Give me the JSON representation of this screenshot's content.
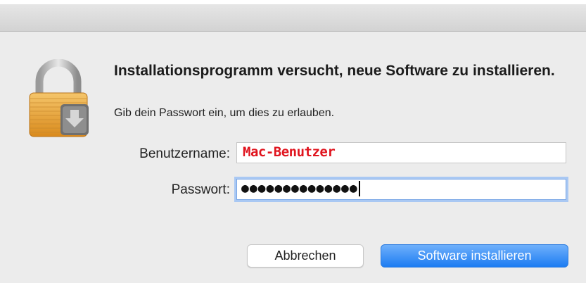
{
  "dialog": {
    "title": "Installationsprogramm versucht, neue Software zu installieren.",
    "subtitle": "Gib dein Passwort ein, um dies zu erlauben.",
    "icon": "lock-icon",
    "username_label": "Benutzername:",
    "username_value": "Mac-Benutzer",
    "password_label": "Passwort:",
    "password_masked": "●●●●●●●●●●●●●●",
    "cancel_label": "Abbrechen",
    "install_label": "Software installieren",
    "colors": {
      "accent": "#1c7cf2",
      "username_text": "#e0141e"
    }
  }
}
